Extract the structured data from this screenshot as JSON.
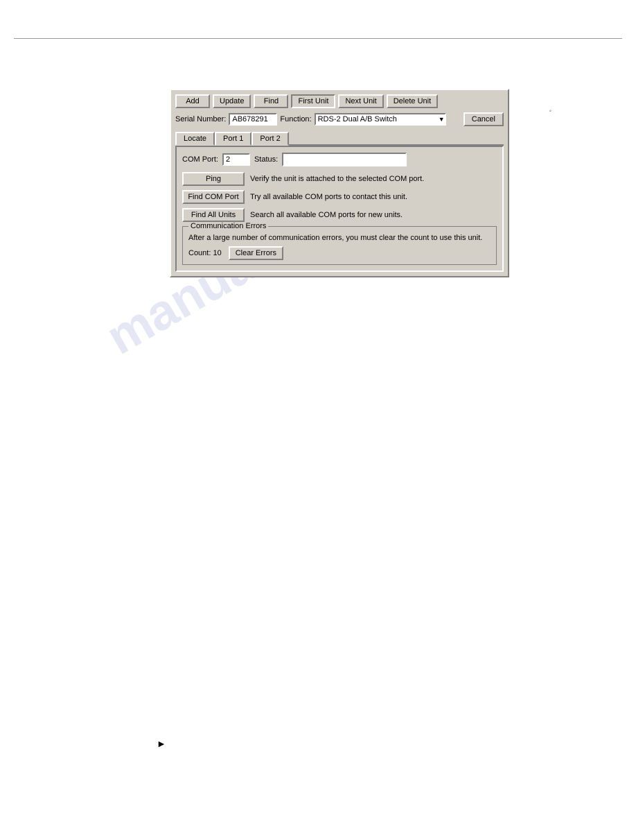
{
  "page": {
    "watermark": "manualshive.com"
  },
  "toolbar": {
    "add_label": "Add",
    "update_label": "Update",
    "find_label": "Find",
    "first_unit_label": "First Unit",
    "next_unit_label": "Next Unit",
    "delete_unit_label": "Delete Unit",
    "cancel_label": "Cancel"
  },
  "serial_row": {
    "serial_label": "Serial Number:",
    "serial_value": "AB678291",
    "function_label": "Function:",
    "function_value": "RDS-2 Dual A/B Switch"
  },
  "tabs": {
    "locate_label": "Locate",
    "port1_label": "Port 1",
    "port2_label": "Port 2"
  },
  "locate_tab": {
    "com_port_label": "COM Port:",
    "com_port_value": "2",
    "status_label": "Status:",
    "status_value": "",
    "ping_label": "Ping",
    "ping_desc": "Verify the unit is attached to the selected COM port.",
    "find_com_label": "Find COM Port",
    "find_com_desc": "Try all available COM ports to contact this unit.",
    "find_all_label": "Find All Units",
    "find_all_desc": "Search all available COM ports for new units.",
    "comm_errors": {
      "legend": "Communication Errors",
      "message": "After a large number of communication errors, you must clear the count to use this unit.",
      "count_label": "Count: 10",
      "clear_label": "Clear Errors"
    }
  }
}
